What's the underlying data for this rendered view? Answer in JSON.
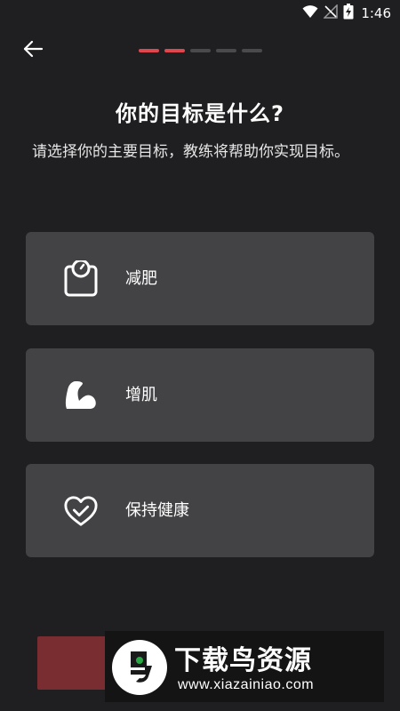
{
  "status_bar": {
    "time": "1:46",
    "icons": [
      "wifi-icon",
      "no-signal-icon",
      "battery-charging-icon"
    ]
  },
  "header": {
    "back_icon": "arrow-left-icon",
    "progress": {
      "current_step": 2,
      "total_steps": 5
    }
  },
  "main": {
    "title": "你的目标是什么?",
    "subtitle": "请选择你的主要目标，教练将帮助你实现目标。",
    "options": [
      {
        "label": "减肥",
        "icon": "weight-scale-icon"
      },
      {
        "label": "增肌",
        "icon": "flexed-biceps-icon"
      },
      {
        "label": "保持健康",
        "icon": "heart-check-icon"
      }
    ]
  },
  "watermark": {
    "title": "下载鸟资源",
    "url": "www.xiazainiao.com"
  },
  "colors": {
    "background": "#1f1f21",
    "card": "#434345",
    "accent": "#e0464e",
    "button": "#7a2d30"
  }
}
